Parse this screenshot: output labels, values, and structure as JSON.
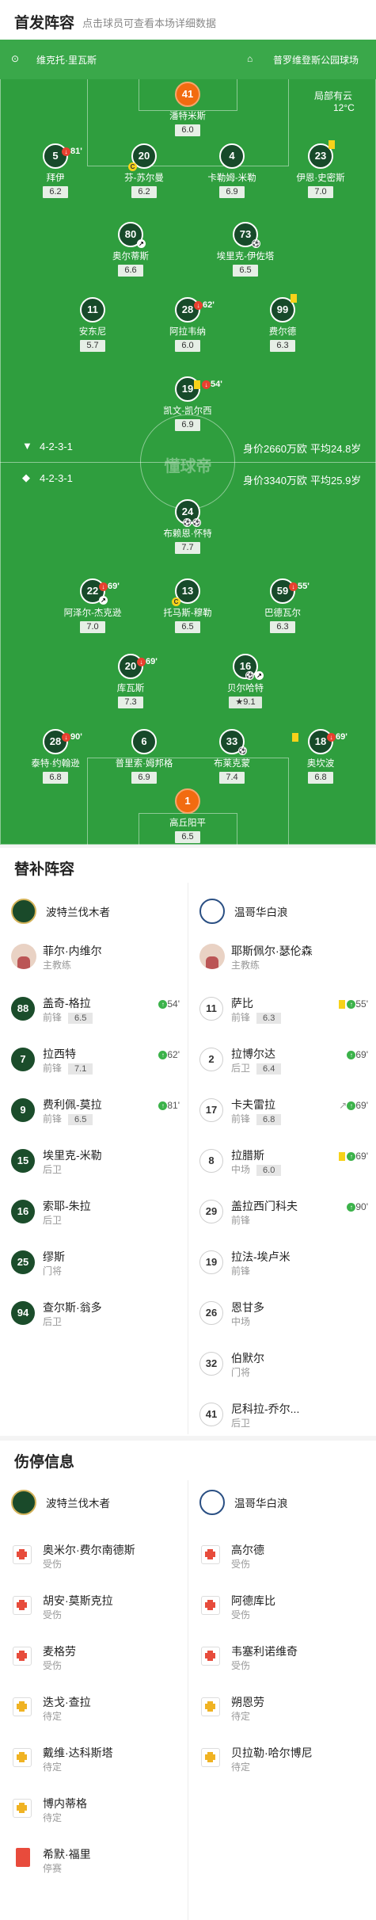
{
  "header": {
    "title": "首发阵容",
    "subtitle": "点击球员可查看本场详细数据"
  },
  "pitch": {
    "home_coach": "维克托·里瓦斯",
    "stadium": "普罗维登斯公园球场",
    "weather": "局部有云",
    "temp": "12°C",
    "home_formation": "4-2-3-1",
    "home_value": "身价2660万欧",
    "home_age": "平均24.8岁",
    "away_formation": "4-2-3-1",
    "away_value": "身价3340万欧",
    "away_age": "平均25.9岁",
    "watermark": "懂球帝",
    "players": [
      {
        "n": "41",
        "name": "潘特米斯",
        "r": "6.0",
        "gk": true
      },
      {
        "n": "5",
        "name": "拜伊",
        "r": "6.2",
        "ev": "81'"
      },
      {
        "n": "20",
        "name": "芬-苏尔曼",
        "r": "6.2"
      },
      {
        "n": "4",
        "name": "卡勒姆-米勒",
        "r": "6.9"
      },
      {
        "n": "23",
        "name": "伊恩·史密斯",
        "r": "7.0"
      },
      {
        "n": "80",
        "name": "奥尔蒂斯",
        "r": "6.6"
      },
      {
        "n": "73",
        "name": "埃里克-伊佐塔",
        "r": "6.5"
      },
      {
        "n": "11",
        "name": "安东尼",
        "r": "5.7"
      },
      {
        "n": "28",
        "name": "阿拉韦纳",
        "r": "6.0",
        "ev": "62'"
      },
      {
        "n": "99",
        "name": "费尔德",
        "r": "6.3"
      },
      {
        "n": "19",
        "name": "凯文-凯尔西",
        "r": "6.9",
        "ev": "54'"
      },
      {
        "n": "24",
        "name": "布赖恩·怀特",
        "r": "7.7"
      },
      {
        "n": "22",
        "name": "阿泽尔-杰克逊",
        "r": "7.0",
        "ev": "69'"
      },
      {
        "n": "13",
        "name": "托马斯-穆勒",
        "r": "6.5"
      },
      {
        "n": "59",
        "name": "巴德瓦尔",
        "r": "6.3",
        "ev": "55'"
      },
      {
        "n": "20",
        "name": "库瓦斯",
        "r": "7.3",
        "ev": "69'"
      },
      {
        "n": "16",
        "name": "贝尔哈特",
        "r": "9.1"
      },
      {
        "n": "28",
        "name": "泰特·约翰逊",
        "r": "6.8",
        "ev": "90'"
      },
      {
        "n": "6",
        "name": "普里索·姆邦格",
        "r": "6.9"
      },
      {
        "n": "33",
        "name": "布莱克蒙",
        "r": "7.4"
      },
      {
        "n": "18",
        "name": "奥坎波",
        "r": "6.8",
        "ev": "69'"
      },
      {
        "n": "1",
        "name": "高丘阳平",
        "r": "6.5",
        "gk": true
      }
    ]
  },
  "subs": {
    "title": "替补阵容",
    "home_team": "波特兰伐木者",
    "away_team": "温哥华白浪",
    "home_coach": {
      "name": "菲尔·内维尔",
      "role": "主教练"
    },
    "away_coach": {
      "name": "耶斯佩尔·瑟伦森",
      "role": "主教练"
    },
    "home": [
      {
        "n": "88",
        "name": "盖奇-格拉",
        "pos": "前锋",
        "r": "6.5",
        "ev": "54'"
      },
      {
        "n": "7",
        "name": "拉西特",
        "pos": "前锋",
        "r": "7.1",
        "ev": "62'"
      },
      {
        "n": "9",
        "name": "费利佩-莫拉",
        "pos": "前锋",
        "r": "6.5",
        "ev": "81'"
      },
      {
        "n": "15",
        "name": "埃里克-米勒",
        "pos": "后卫"
      },
      {
        "n": "16",
        "name": "索耶-朱拉",
        "pos": "后卫"
      },
      {
        "n": "25",
        "name": "缪斯",
        "pos": "门将"
      },
      {
        "n": "94",
        "name": "查尔斯·翁多",
        "pos": "后卫"
      }
    ],
    "away": [
      {
        "n": "11",
        "name": "萨比",
        "pos": "前锋",
        "r": "6.3",
        "ev": "55'"
      },
      {
        "n": "2",
        "name": "拉博尔达",
        "pos": "后卫",
        "r": "6.4",
        "ev": "69'"
      },
      {
        "n": "17",
        "name": "卡夫雷拉",
        "pos": "前锋",
        "r": "6.8",
        "ev": "69'"
      },
      {
        "n": "8",
        "name": "拉腊斯",
        "pos": "中场",
        "r": "6.0",
        "ev": "69'"
      },
      {
        "n": "29",
        "name": "盖拉西门科夫",
        "pos": "前锋",
        "ev": "90'"
      },
      {
        "n": "19",
        "name": "拉法-埃卢米",
        "pos": "前锋"
      },
      {
        "n": "26",
        "name": "恩甘多",
        "pos": "中场"
      },
      {
        "n": "32",
        "name": "伯默尔",
        "pos": "门将"
      },
      {
        "n": "41",
        "name": "尼科拉-乔尔...",
        "pos": "后卫"
      }
    ]
  },
  "injuries": {
    "title": "伤停信息",
    "home_team": "波特兰伐木者",
    "away_team": "温哥华白浪",
    "home": [
      {
        "name": "奥米尔·费尔南德斯",
        "status": "受伤",
        "k": "red"
      },
      {
        "name": "胡安·莫斯克拉",
        "status": "受伤",
        "k": "red"
      },
      {
        "name": "麦格劳",
        "status": "受伤",
        "k": "red"
      },
      {
        "name": "迭戈·查拉",
        "status": "待定",
        "k": "yellow"
      },
      {
        "name": "戴维·达科斯塔",
        "status": "待定",
        "k": "yellow"
      },
      {
        "name": "博内蒂格",
        "status": "待定",
        "k": "yellow"
      },
      {
        "name": "希默·福里",
        "status": "停赛",
        "k": "card"
      }
    ],
    "away": [
      {
        "name": "高尔德",
        "status": "受伤",
        "k": "red"
      },
      {
        "name": "阿德库比",
        "status": "受伤",
        "k": "red"
      },
      {
        "name": "韦塞利诺维奇",
        "status": "受伤",
        "k": "red"
      },
      {
        "name": "朔恩劳",
        "status": "待定",
        "k": "yellow"
      },
      {
        "name": "贝拉勒·哈尔博尼",
        "status": "待定",
        "k": "yellow"
      }
    ]
  }
}
